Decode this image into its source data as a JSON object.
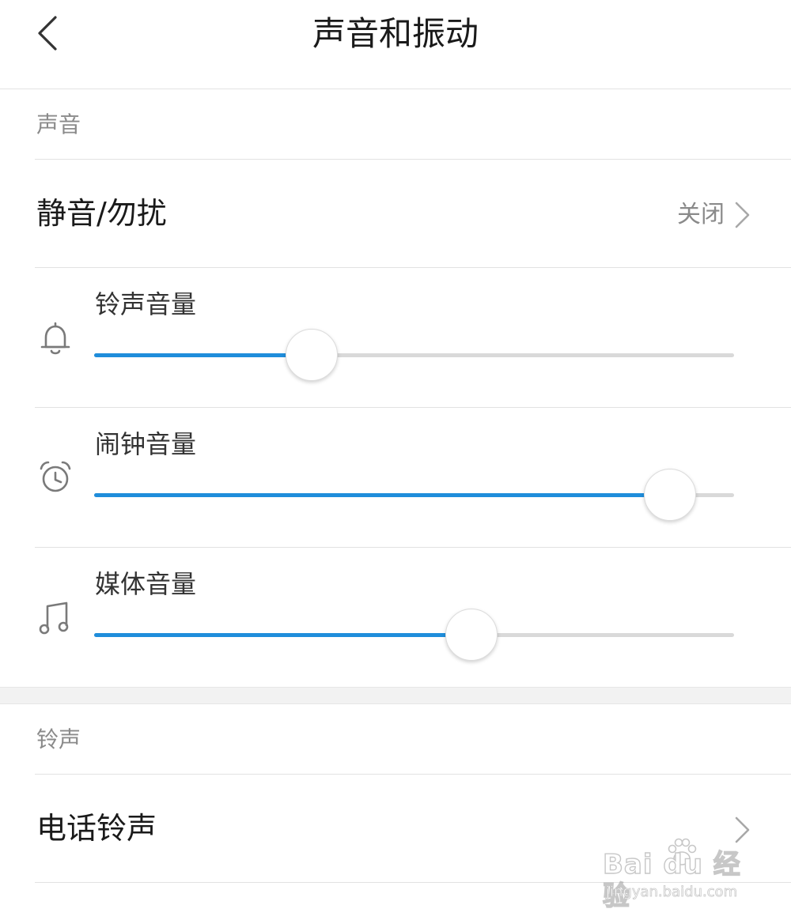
{
  "header": {
    "title": "声音和振动",
    "back_icon": "chevron-left-icon"
  },
  "sound_section": {
    "label": "声音",
    "dnd": {
      "label": "静音/勿扰",
      "value": "关闭",
      "icon": "chevron-right-icon"
    },
    "volumes": [
      {
        "label": "铃声音量",
        "icon": "bell-icon",
        "level": 0.34
      },
      {
        "label": "闹钟音量",
        "icon": "alarm-clock-icon",
        "level": 0.9
      },
      {
        "label": "媒体音量",
        "icon": "music-note-icon",
        "level": 0.59
      }
    ]
  },
  "ringtone_section": {
    "label": "铃声",
    "phone_ringtone": {
      "label": "电话铃声",
      "icon": "chevron-right-icon"
    }
  },
  "colors": {
    "accent": "#1f8ddb",
    "track": "#d9d9d9",
    "text": "#1a1a1a",
    "secondary_text": "#8a8a8a"
  },
  "watermark": {
    "line1": "Bai du 经验",
    "line2": "jingyan.baidu.com"
  }
}
